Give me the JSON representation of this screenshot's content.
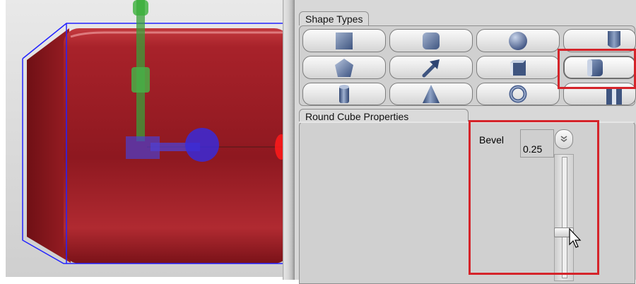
{
  "shape_types": {
    "title": "Shape Types",
    "buttons": [
      {
        "icon": "cube-icon"
      },
      {
        "icon": "rounded-cube-icon"
      },
      {
        "icon": "sphere-icon"
      },
      {
        "icon": "cylinder-partial-icon"
      },
      {
        "icon": "pentagon-prism-icon"
      },
      {
        "icon": "arrow-icon"
      },
      {
        "icon": "chamfer-cube-icon"
      },
      {
        "icon": "round-cube-icon",
        "selected": true
      },
      {
        "icon": "cylinder-icon"
      },
      {
        "icon": "cone-icon"
      },
      {
        "icon": "torus-icon"
      },
      {
        "icon": "tube-icon"
      }
    ]
  },
  "round_cube_properties": {
    "title": "Round Cube Properties",
    "bevel": {
      "label": "Bevel",
      "value": "0.25",
      "dropdown_icon": "double-chevron-down-icon",
      "slider_level": 0.25
    }
  },
  "colors": {
    "highlight": "#d5242a",
    "cube": "#9c1c24",
    "gizmo_green": "#3aa03a",
    "gizmo_blue": "#4b3fcf"
  }
}
